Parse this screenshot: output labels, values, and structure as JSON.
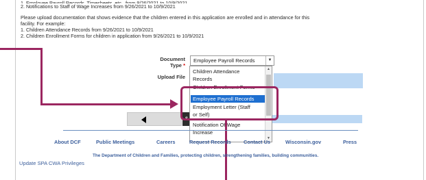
{
  "content": {
    "item1_partial": "1. Employee Payroll Records, Timesheets, etc., from 9/26/2021 to 10/9/2021",
    "item2": "2. Notifications to Staff of Wage Increases from 9/26/2021 to 10/9/2021",
    "instructions_line1": "Please upload documentation that shows evidence that the children entered in this application are enrolled and in attendance for this",
    "instructions_line2": "facility. For example:",
    "example1": "1. Children Attendance Records from 9/26/2021 to 10/9/2021",
    "example2": "2. Children Enrollment Forms for children in application from 9/26/2021 to 10/9/2021"
  },
  "form": {
    "document_type_label_line1": "Document",
    "document_type_label_line2": "Type",
    "required_marker": "*",
    "document_type_value": "Employee Payroll Records",
    "upload_file_label": "Upload File"
  },
  "dropdown": {
    "options": [
      {
        "line1": "Children Attendance",
        "line2": "Records"
      },
      {
        "line1": "Children Enrollment Forms"
      },
      {
        "line1": "Employee Payroll Records",
        "selected": true
      },
      {
        "line1": "Employment Letter (Staff",
        "line2": "or Self)"
      },
      {
        "line1": "Notification Of Wage",
        "line2": "Increase"
      }
    ]
  },
  "nav": {
    "next_partial": "S"
  },
  "footer": {
    "links": [
      "About DCF",
      "Public Meetings",
      "Careers",
      "Request Records",
      "Contact Us",
      "Wisconsin.gov",
      "Press"
    ],
    "tagline": "The Department of Children and Families, protecting children, strengthening families, building communities.",
    "update_link": "Update SPA CWA Privileges"
  },
  "colors": {
    "annotation": "#9b2660",
    "selected_option": "#1e6fd0",
    "link": "#3c5f9c",
    "upload_field": "#bcd8f4"
  }
}
